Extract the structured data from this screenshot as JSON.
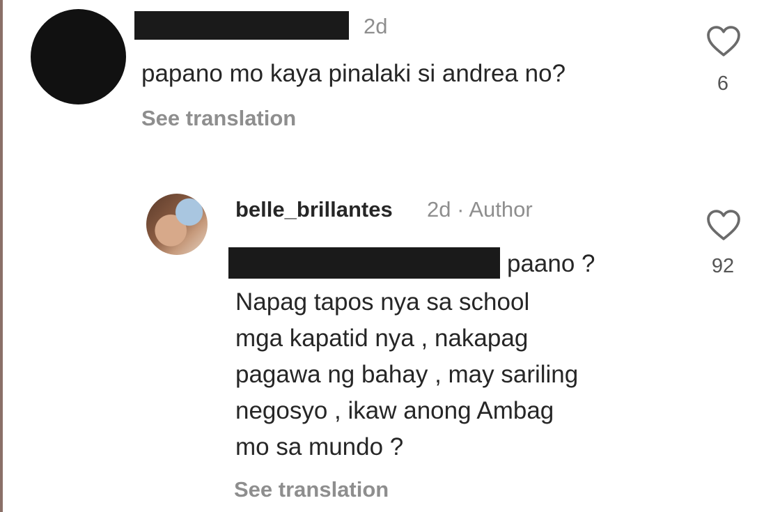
{
  "comment": {
    "time": "2d",
    "text": "papano mo kaya pinalaki si andrea no?",
    "see_translation": "See translation",
    "like_count": "6"
  },
  "reply": {
    "username": "belle_brillantes",
    "meta": "2d · Author",
    "lines": [
      "paano ?",
      "Napag tapos nya sa school",
      "mga kapatid nya , nakapag",
      "pagawa ng bahay , may sariling",
      "negosyo , ikaw anong Ambag",
      "mo sa mundo ?"
    ],
    "see_translation": "See translation",
    "like_count": "92"
  },
  "icons": {
    "comment_like": "heart-outline-icon",
    "reply_like": "heart-outline-icon"
  },
  "colors": {
    "text": "#262626",
    "muted": "#8e8e8e",
    "redaction": "#1a1a1a"
  }
}
